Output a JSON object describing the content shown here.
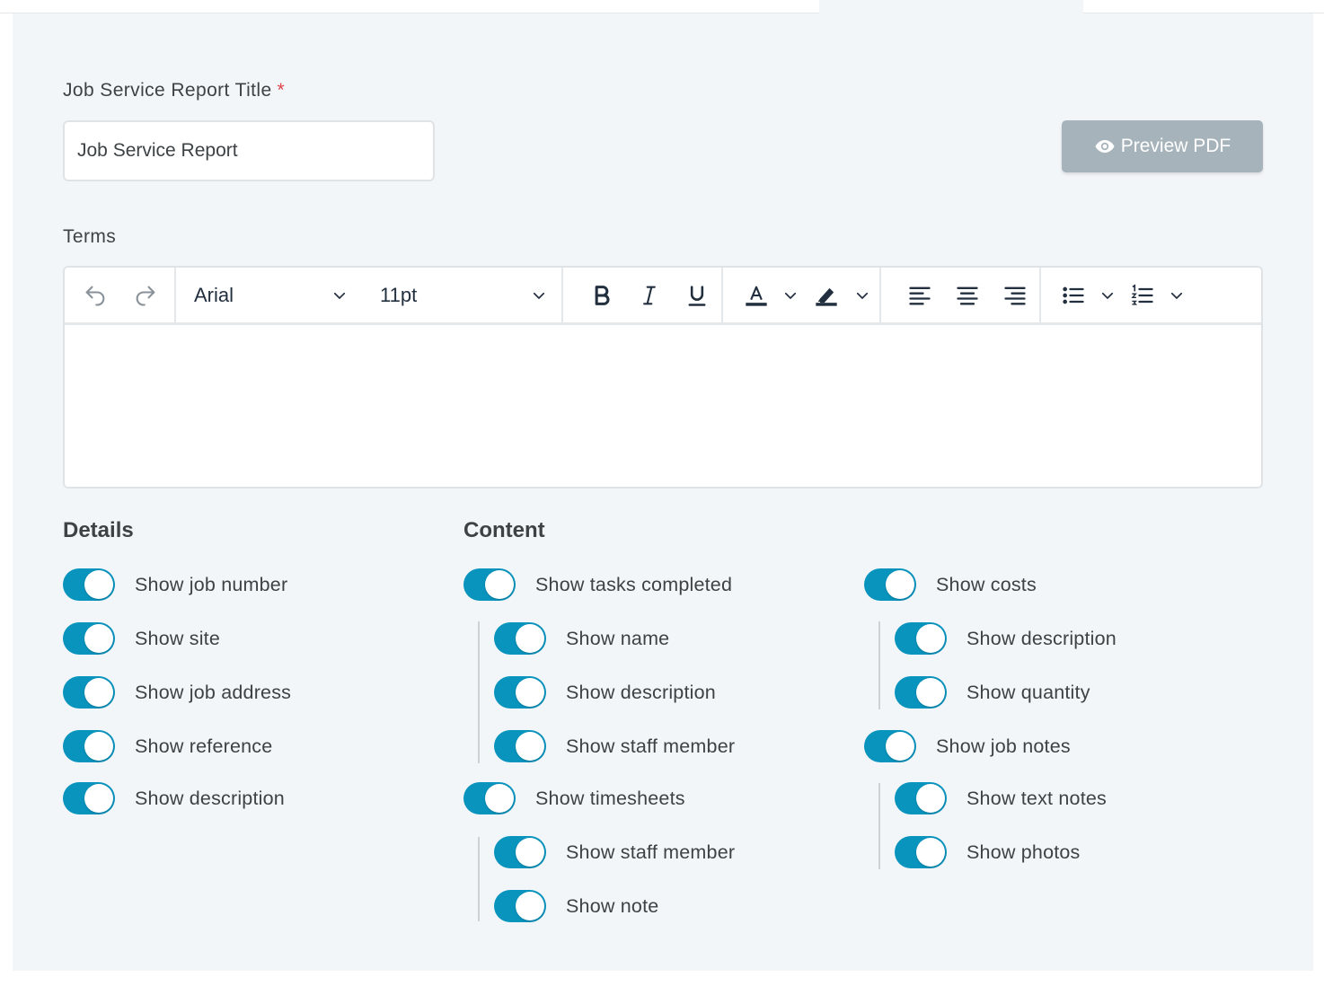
{
  "form": {
    "title_label": "Job Service Report Title",
    "required_mark": "*",
    "title_value": "Job Service Report",
    "preview_button": "Preview PDF",
    "terms_label": "Terms"
  },
  "editor": {
    "font_family": "Arial",
    "font_size": "11pt",
    "text_color_accent": "#222f3e"
  },
  "sections": {
    "details": {
      "title": "Details",
      "toggles": [
        {
          "label": "Show job number",
          "on": true
        },
        {
          "label": "Show site",
          "on": true
        },
        {
          "label": "Show job address",
          "on": true
        },
        {
          "label": "Show reference",
          "on": true
        },
        {
          "label": "Show description",
          "on": true
        }
      ]
    },
    "content": {
      "title": "Content",
      "tasks": {
        "label": "Show tasks completed",
        "on": true
      },
      "tasks_children": [
        {
          "label": "Show name",
          "on": true
        },
        {
          "label": "Show description",
          "on": true
        },
        {
          "label": "Show staff member",
          "on": true
        }
      ],
      "timesheets": {
        "label": "Show timesheets",
        "on": true
      },
      "timesheets_children": [
        {
          "label": "Show staff member",
          "on": true
        },
        {
          "label": "Show note",
          "on": true
        }
      ],
      "costs": {
        "label": "Show costs",
        "on": true
      },
      "costs_children": [
        {
          "label": "Show description",
          "on": true
        },
        {
          "label": "Show quantity",
          "on": true
        }
      ],
      "job_notes": {
        "label": "Show job notes",
        "on": true
      },
      "job_notes_children": [
        {
          "label": "Show text notes",
          "on": true
        },
        {
          "label": "Show photos",
          "on": true
        }
      ]
    }
  },
  "colors": {
    "toggle_on": "#0994be",
    "preview_button": "#a6b3bb",
    "required": "#e0454b"
  }
}
